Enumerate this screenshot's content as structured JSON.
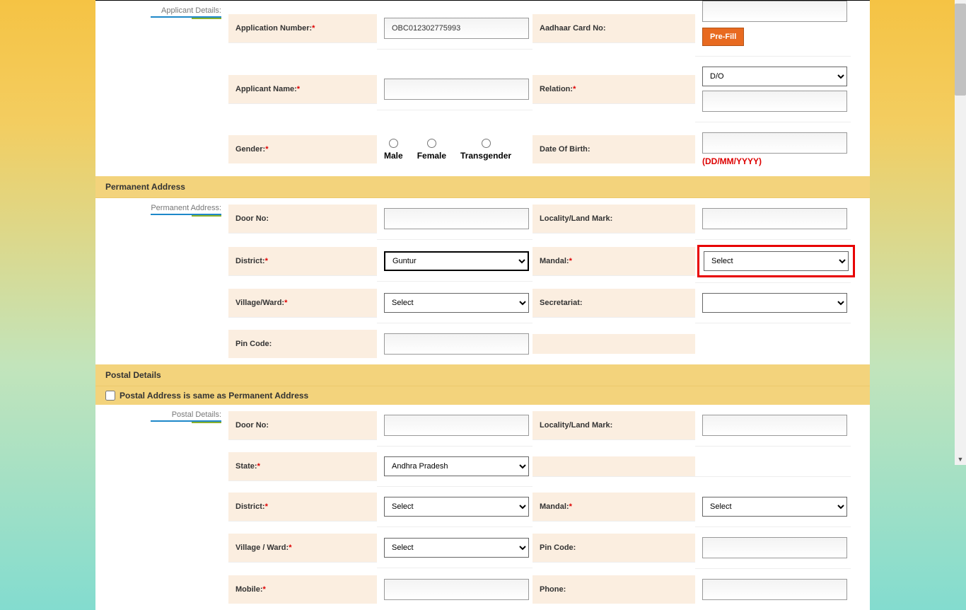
{
  "sections": {
    "applicant": {
      "sidebar": "Applicant Details:",
      "appNumberLabel": "Application Number:",
      "appNumberValue": "OBC012302775993",
      "aadhaarLabel": "Aadhaar Card No:",
      "prefill": "Pre-Fill",
      "applicantNameLabel": "Applicant Name:",
      "relationLabel": "Relation:",
      "relationSelected": "D/O",
      "genderLabel": "Gender:",
      "genderMale": "Male",
      "genderFemale": "Female",
      "genderTrans": "Transgender",
      "dobLabel": "Date Of Birth:",
      "dobHint": "(DD/MM/YYYY)"
    },
    "permAddr": {
      "header": "Permanent Address",
      "sidebar": "Permanent Address:",
      "doorNo": "Door No:",
      "locality": "Locality/Land Mark:",
      "district": "District:",
      "districtSelected": "Guntur",
      "mandal": "Mandal:",
      "mandalSelected": "Select",
      "village": "Village/Ward:",
      "villageSelected": "Select",
      "secretariat": "Secretariat:",
      "pincode": "Pin Code:"
    },
    "postal": {
      "header": "Postal Details",
      "sameAs": "Postal Address is same as Permanent Address",
      "sidebar": "Postal Details:",
      "doorNo": "Door No:",
      "locality": "Locality/Land Mark:",
      "state": "State:",
      "stateSelected": "Andhra Pradesh",
      "district": "District:",
      "districtSelected": "Select",
      "mandal": "Mandal:",
      "mandalSelected": "Select",
      "village": "Village / Ward:",
      "villageSelected": "Select",
      "pincode": "Pin Code:",
      "mobile": "Mobile:",
      "phone": "Phone:"
    }
  }
}
